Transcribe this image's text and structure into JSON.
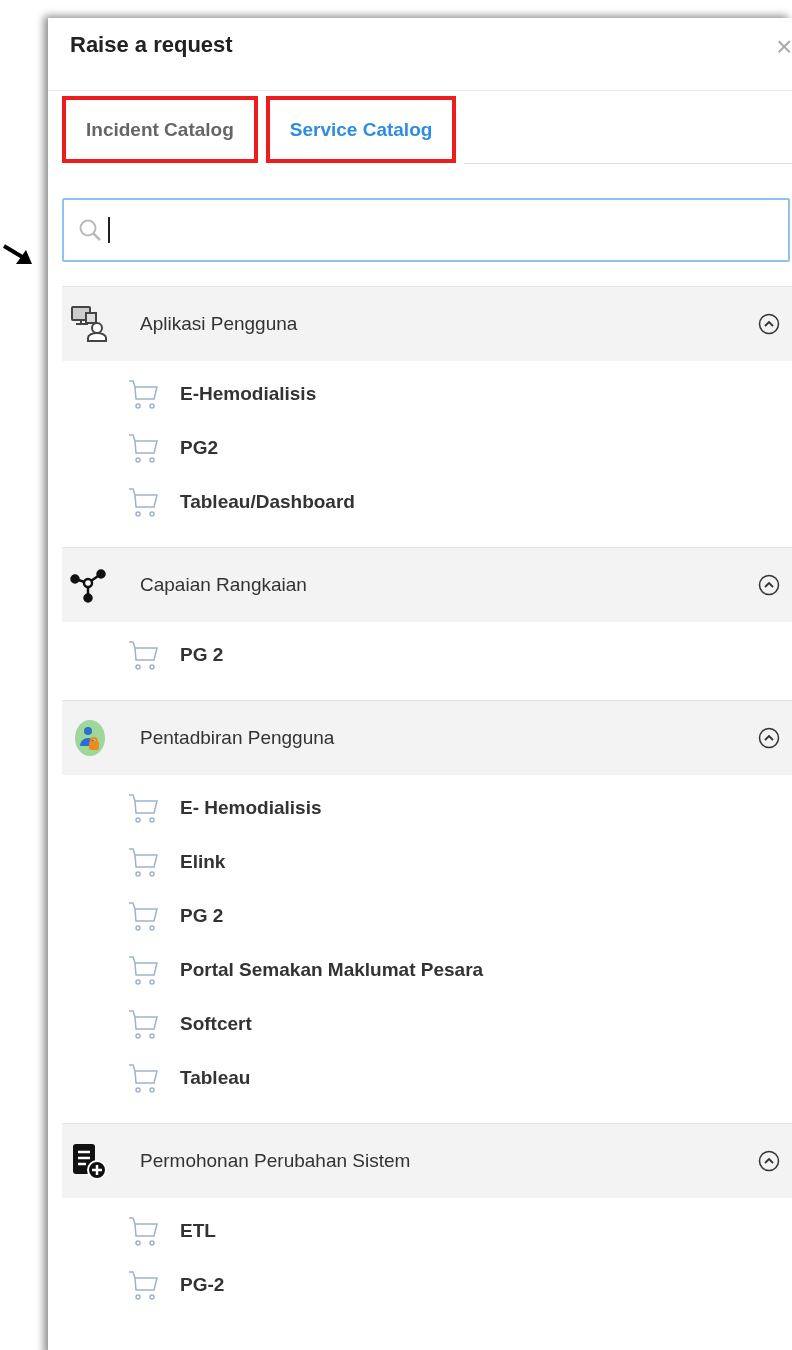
{
  "dialog": {
    "title": "Raise a request",
    "close": "×"
  },
  "tabs": [
    {
      "label": "Incident Catalog",
      "selected": false,
      "highlighted": true
    },
    {
      "label": "Service Catalog",
      "selected": true,
      "highlighted": true
    }
  ],
  "categories": [
    {
      "name": "Aplikasi Pengguna",
      "kind": "apps",
      "expanded": true,
      "items": [
        "E-Hemodialisis",
        "PG2",
        "Tableau/Dashboard"
      ]
    },
    {
      "name": "Capaian Rangkaian",
      "kind": "network",
      "expanded": true,
      "items": [
        "PG 2"
      ]
    },
    {
      "name": "Pentadbiran Pengguna",
      "kind": "admin",
      "expanded": true,
      "items": [
        "E- Hemodialisis",
        "Elink",
        "PG 2",
        "Portal Semakan Maklumat Pesara",
        "Softcert",
        "Tableau"
      ]
    },
    {
      "name": "Permohonan Perubahan Sistem",
      "kind": "change",
      "expanded": true,
      "items": [
        "ETL",
        "PG-2"
      ]
    }
  ]
}
